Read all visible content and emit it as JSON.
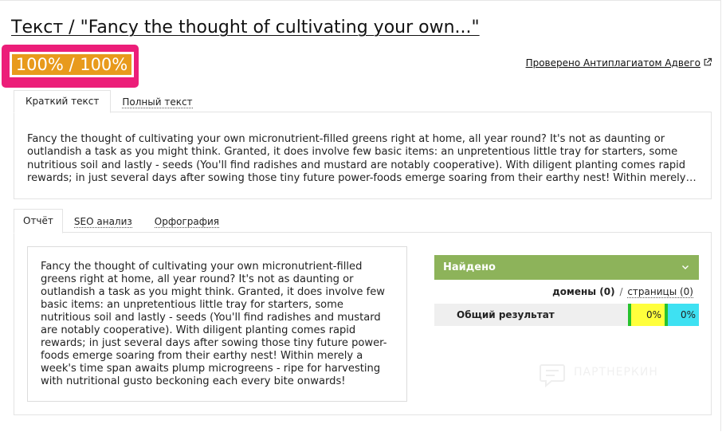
{
  "header": {
    "title": "Текст / \"Fancy the thought of cultivating your own...\"",
    "score": "100% / 100%",
    "check_link": "Проверено Антиплагиатом Адвего"
  },
  "text_tabs": [
    {
      "label": "Краткий текст",
      "active": true
    },
    {
      "label": "Полный текст",
      "active": false
    }
  ],
  "preview_text": "Fancy the thought of cultivating your own micronutrient-filled greens right at home, all year round? It's not as daunting or outlandish a task as you might think. Granted, it does involve few basic items: an unpretentious little tray for starters, some nutritious soil and lastly - seeds (You'll find radishes and mustard are notably cooperative). With diligent planting comes rapid rewards; in just several days after sowing those tiny future power-foods emerge soaring from their earthy nest! Within merely a week's time span awaits plump microgreens - ripe for harvesting with nutritional gusto beckoning each every bite onwards!",
  "report_tabs": [
    {
      "label": "Отчёт",
      "active": true
    },
    {
      "label": "SEO анализ",
      "active": false
    },
    {
      "label": "Орфография",
      "active": false
    }
  ],
  "report_text": "Fancy the thought of cultivating your own micronutrient-filled greens right at home, all year round? It's not as daunting or outlandish a task as you might think. Granted, it does involve few basic items: an unpretentious little tray for starters, some nutritious soil and lastly - seeds (You'll find radishes and mustard are notably cooperative). With diligent planting comes rapid rewards; in just several days after sowing those tiny future power-foods emerge soaring from their earthy nest! Within merely a week's time span awaits plump microgreens - ripe for harvesting with nutritional gusto beckoning each every bite onwards!",
  "results": {
    "header": "Найдено",
    "domains_label": "домены (0)",
    "separator": "/",
    "pages_label": "страницы (0)",
    "overall_label": "Общий результат",
    "value_a": "0%",
    "value_b": "0%"
  },
  "watermark": "ПАРТНЕРКИН",
  "icons": {
    "external_link": "external-link-icon",
    "chevron": "chevron-down-icon",
    "watermark_logo": "chat-bubble-logo-icon"
  },
  "colors": {
    "score_badge": "#e89a1c",
    "highlight_frame": "#ec1e79",
    "found_header": "#8db35a",
    "cell_a": "#ffff3c",
    "cell_b": "#3ee1f2",
    "cell_border": "#27c22e"
  }
}
